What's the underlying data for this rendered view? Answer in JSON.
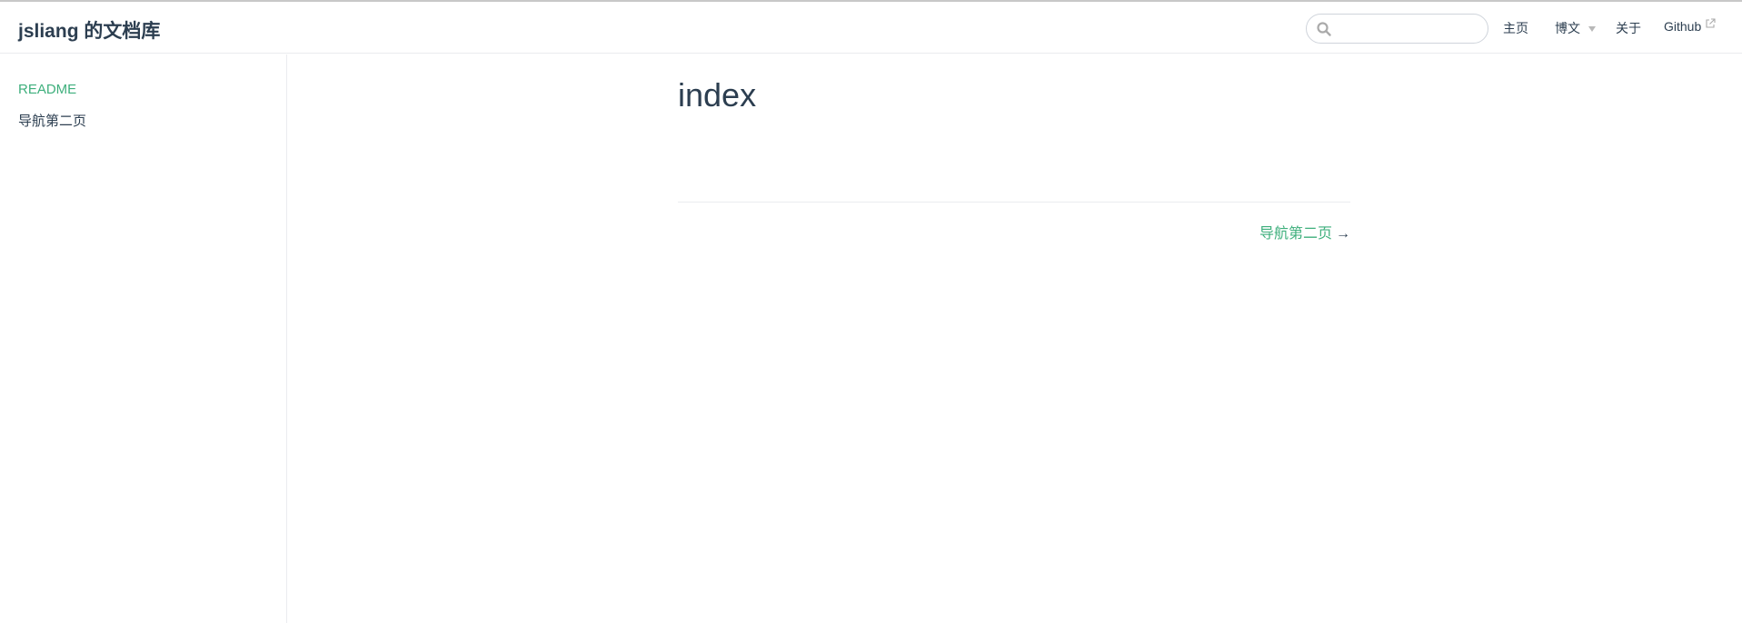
{
  "site": {
    "name": "jsliang 的文档库"
  },
  "search": {
    "placeholder": "",
    "value": ""
  },
  "nav": {
    "home": "主页",
    "blog": "博文",
    "about": "关于",
    "github": "Github"
  },
  "sidebar": {
    "items": [
      {
        "label": "README",
        "active": true
      },
      {
        "label": "导航第二页",
        "active": false
      }
    ]
  },
  "page": {
    "title": "index",
    "next_label": "导航第二页",
    "next_arrow": "→"
  },
  "colors": {
    "accent": "#3eaf7c",
    "text": "#2c3e50",
    "border": "#eaecef"
  },
  "icons": [
    "search-icon",
    "chevron-down-icon",
    "external-link-icon",
    "arrow-right-icon"
  ]
}
